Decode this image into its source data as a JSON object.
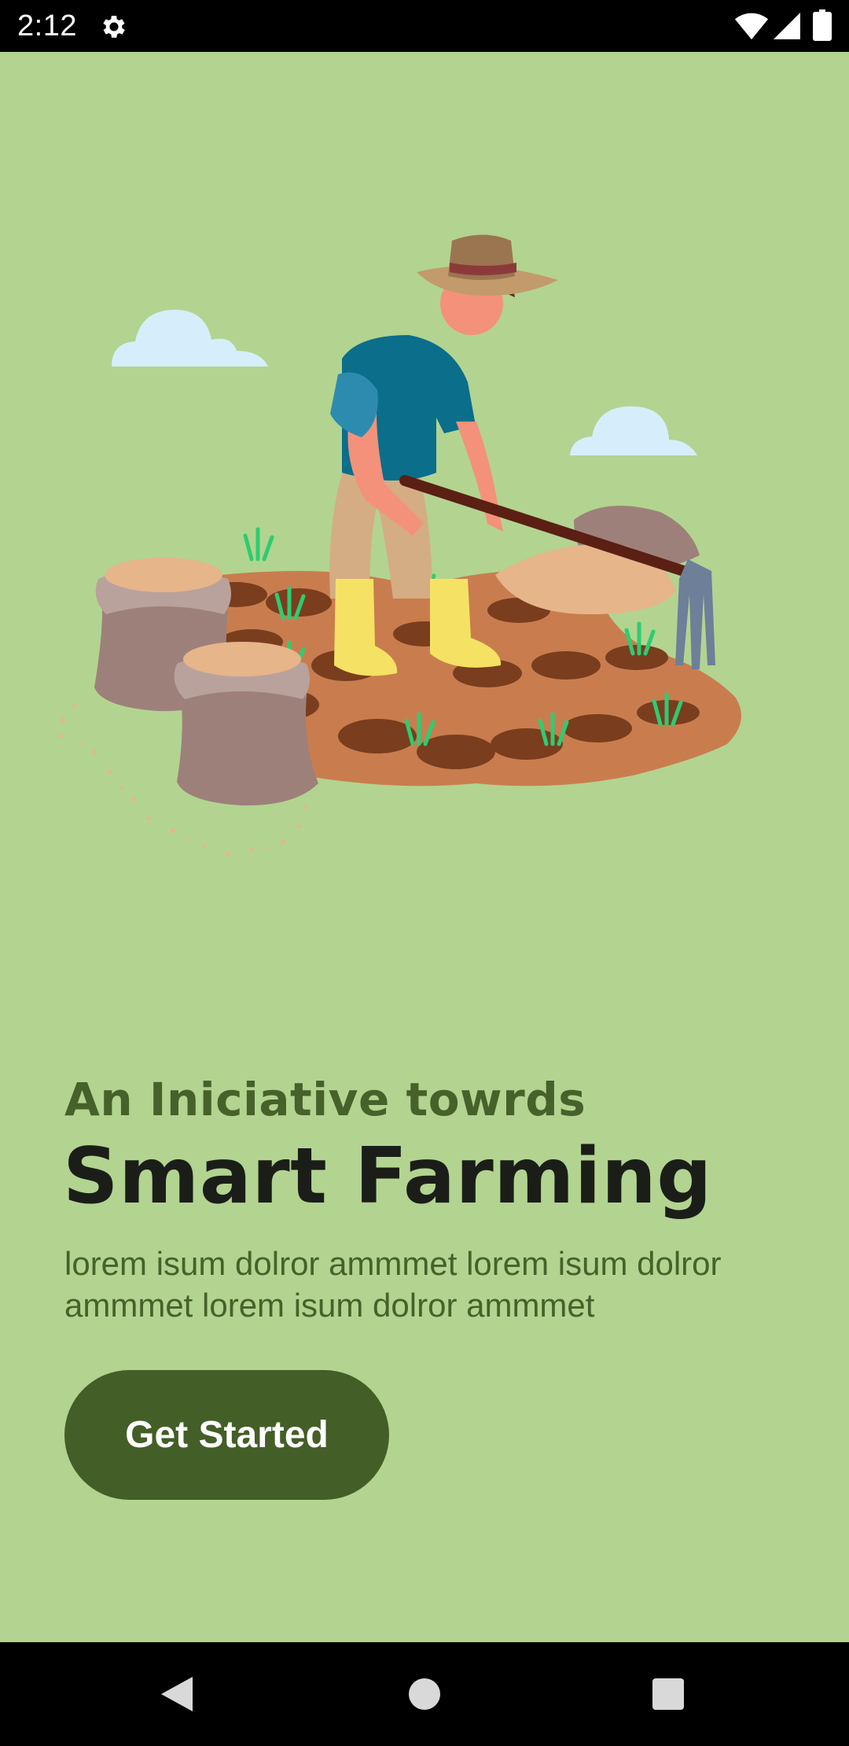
{
  "status_bar": {
    "time": "2:12",
    "icons": [
      "gear-icon",
      "wifi-icon",
      "signal-icon",
      "battery-icon"
    ]
  },
  "illustration": {
    "subject": "farmer-hoeing-field-illustration",
    "icon": "farmer-illustration"
  },
  "onboarding": {
    "subtitle": "An Iniciative towrds",
    "title": "Smart Farming",
    "description": "lorem isum dolror ammmet lorem isum dolror ammmet lorem isum dolror ammmet",
    "cta_label": "Get Started"
  },
  "nav_bar": {
    "icons": [
      "back-icon",
      "home-icon",
      "recents-icon"
    ]
  },
  "colors": {
    "background": "#b2d490",
    "accent_dark_green": "#435e27",
    "subtitle_green": "#46612a",
    "title_dark": "#1b1e18"
  }
}
